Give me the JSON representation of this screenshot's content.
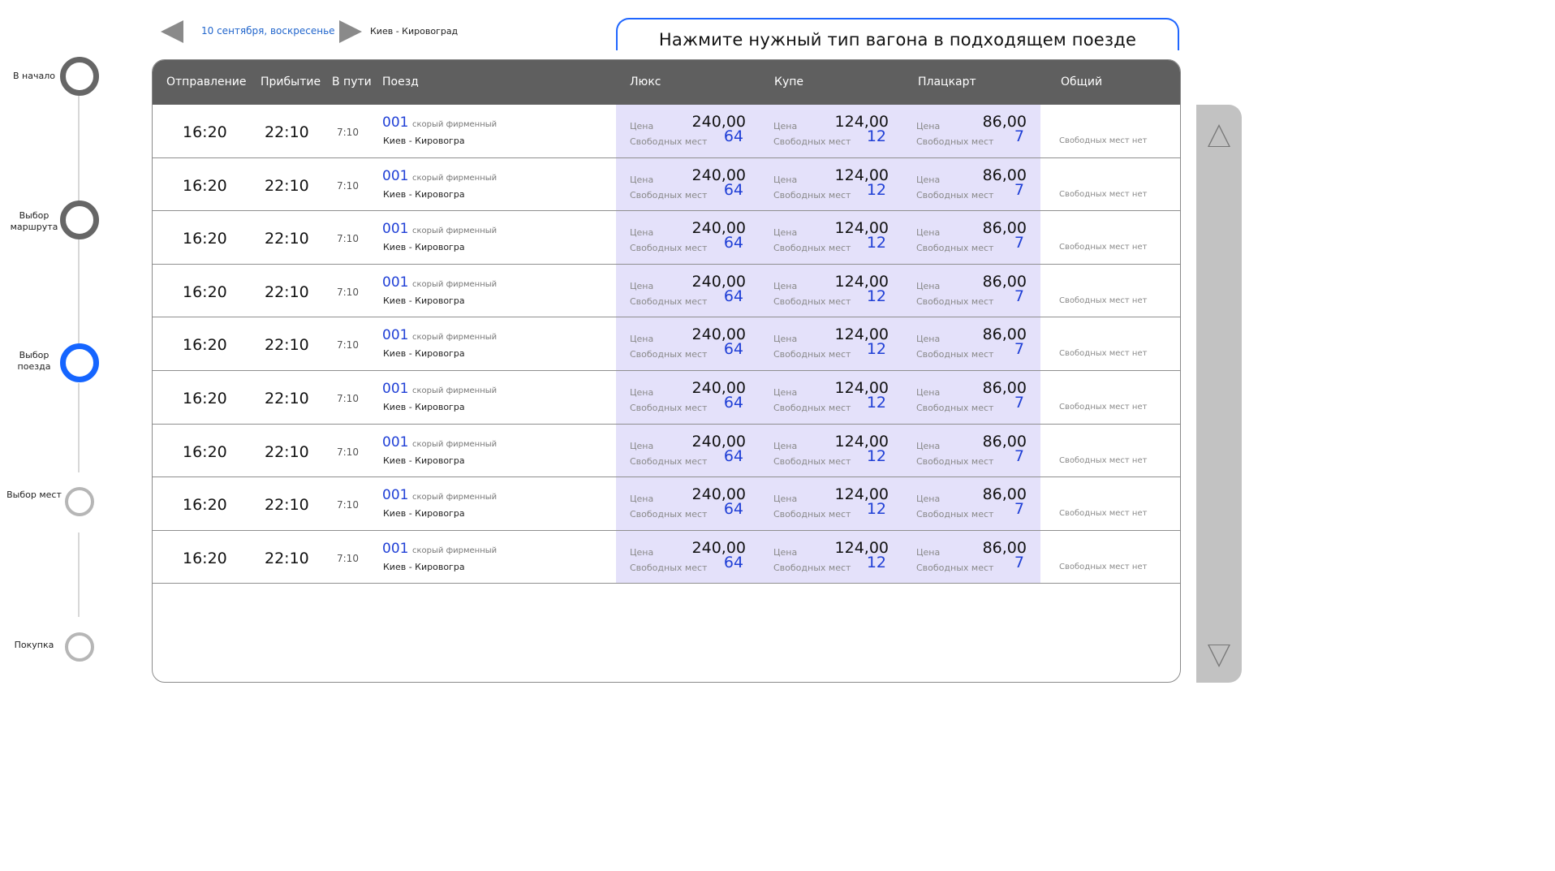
{
  "colors": {
    "accent": "#1565ff",
    "header_bg": "#5f5f5f",
    "fare_bg": "#e4e1fa",
    "link": "#2266cc"
  },
  "stepper": {
    "steps": [
      {
        "label": "В начало",
        "state": "done"
      },
      {
        "label": "Выбор маршрута",
        "state": "done"
      },
      {
        "label": "Выбор поезда",
        "state": "active"
      },
      {
        "label": "Выбор мест",
        "state": "todo"
      },
      {
        "label": "Покупка",
        "state": "todo"
      }
    ]
  },
  "topbar": {
    "prev_icon": "triangle-left-icon",
    "date": "10 сентября, воскресенье",
    "next_icon": "triangle-right-icon",
    "route": "Киев - Кировоград",
    "hint": "Нажмите нужный тип вагона в подходящем поезде"
  },
  "table": {
    "headers": {
      "departure": "Отправление",
      "arrival": "Прибытие",
      "duration": "В пути",
      "train": "Поезд",
      "lux": "Люкс",
      "kupe": "Купе",
      "plackart": "Плацкарт",
      "common": "Общий"
    },
    "labels": {
      "price": "Цена",
      "free_seats": "Свободных мест",
      "no_seats": "Свободных мест нет"
    },
    "rows": [
      {
        "departure": "16:20",
        "arrival": "22:10",
        "duration": "7:10",
        "number": "001",
        "type": "скорый фирменный",
        "route": "Киев - Кировогра",
        "lux": {
          "price": "240,00",
          "seats": "64"
        },
        "kupe": {
          "price": "124,00",
          "seats": "12"
        },
        "plackart": {
          "price": "86,00",
          "seats": "7"
        }
      },
      {
        "departure": "16:20",
        "arrival": "22:10",
        "duration": "7:10",
        "number": "001",
        "type": "скорый фирменный",
        "route": "Киев - Кировогра",
        "lux": {
          "price": "240,00",
          "seats": "64"
        },
        "kupe": {
          "price": "124,00",
          "seats": "12"
        },
        "plackart": {
          "price": "86,00",
          "seats": "7"
        }
      },
      {
        "departure": "16:20",
        "arrival": "22:10",
        "duration": "7:10",
        "number": "001",
        "type": "скорый фирменный",
        "route": "Киев - Кировогра",
        "lux": {
          "price": "240,00",
          "seats": "64"
        },
        "kupe": {
          "price": "124,00",
          "seats": "12"
        },
        "plackart": {
          "price": "86,00",
          "seats": "7"
        }
      },
      {
        "departure": "16:20",
        "arrival": "22:10",
        "duration": "7:10",
        "number": "001",
        "type": "скорый фирменный",
        "route": "Киев - Кировогра",
        "lux": {
          "price": "240,00",
          "seats": "64"
        },
        "kupe": {
          "price": "124,00",
          "seats": "12"
        },
        "plackart": {
          "price": "86,00",
          "seats": "7"
        }
      },
      {
        "departure": "16:20",
        "arrival": "22:10",
        "duration": "7:10",
        "number": "001",
        "type": "скорый фирменный",
        "route": "Киев - Кировогра",
        "lux": {
          "price": "240,00",
          "seats": "64"
        },
        "kupe": {
          "price": "124,00",
          "seats": "12"
        },
        "plackart": {
          "price": "86,00",
          "seats": "7"
        }
      },
      {
        "departure": "16:20",
        "arrival": "22:10",
        "duration": "7:10",
        "number": "001",
        "type": "скорый фирменный",
        "route": "Киев - Кировогра",
        "lux": {
          "price": "240,00",
          "seats": "64"
        },
        "kupe": {
          "price": "124,00",
          "seats": "12"
        },
        "plackart": {
          "price": "86,00",
          "seats": "7"
        }
      },
      {
        "departure": "16:20",
        "arrival": "22:10",
        "duration": "7:10",
        "number": "001",
        "type": "скорый фирменный",
        "route": "Киев - Кировогра",
        "lux": {
          "price": "240,00",
          "seats": "64"
        },
        "kupe": {
          "price": "124,00",
          "seats": "12"
        },
        "plackart": {
          "price": "86,00",
          "seats": "7"
        }
      },
      {
        "departure": "16:20",
        "arrival": "22:10",
        "duration": "7:10",
        "number": "001",
        "type": "скорый фирменный",
        "route": "Киев - Кировогра",
        "lux": {
          "price": "240,00",
          "seats": "64"
        },
        "kupe": {
          "price": "124,00",
          "seats": "12"
        },
        "plackart": {
          "price": "86,00",
          "seats": "7"
        }
      },
      {
        "departure": "16:20",
        "arrival": "22:10",
        "duration": "7:10",
        "number": "001",
        "type": "скорый фирменный",
        "route": "Киев - Кировогра",
        "lux": {
          "price": "240,00",
          "seats": "64"
        },
        "kupe": {
          "price": "124,00",
          "seats": "12"
        },
        "plackart": {
          "price": "86,00",
          "seats": "7"
        }
      }
    ]
  },
  "scrollbar": {
    "up_icon": "triangle-up-icon",
    "down_icon": "triangle-down-icon"
  }
}
